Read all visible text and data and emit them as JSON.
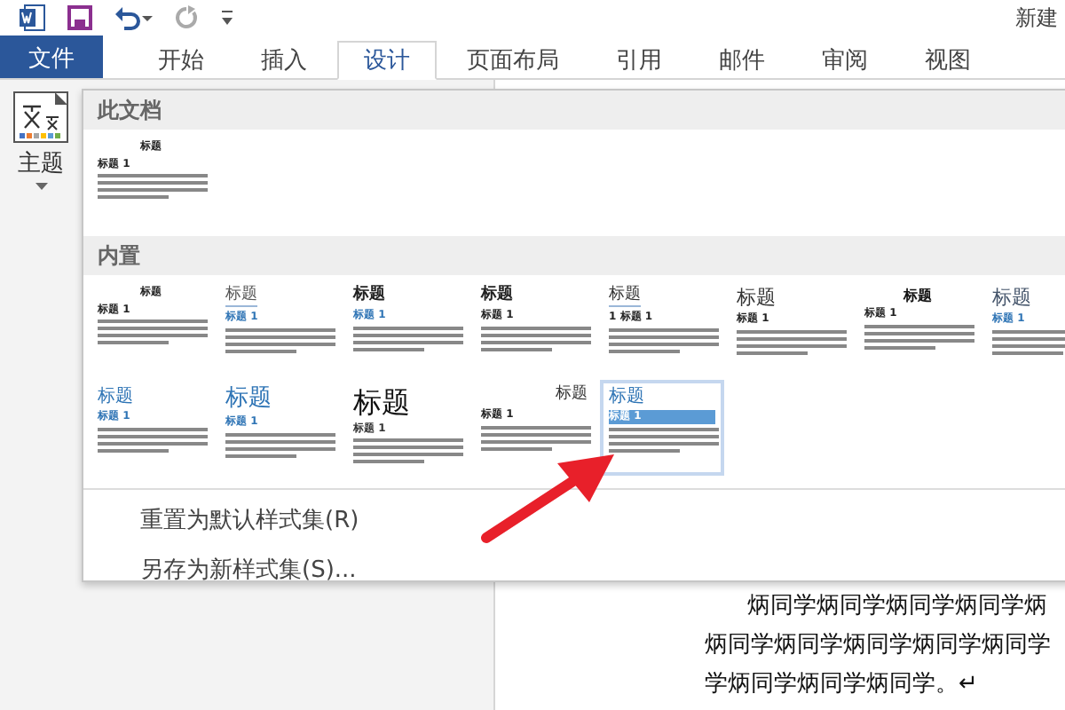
{
  "title_bar": {
    "doc_title": "新建"
  },
  "tabs": [
    {
      "label": "文件",
      "kind": "file",
      "selected": false
    },
    {
      "label": "开始",
      "kind": "tab",
      "selected": false
    },
    {
      "label": "插入",
      "kind": "tab",
      "selected": false
    },
    {
      "label": "设计",
      "kind": "tab",
      "selected": true
    },
    {
      "label": "页面布局",
      "kind": "tab",
      "selected": false
    },
    {
      "label": "引用",
      "kind": "tab",
      "selected": false
    },
    {
      "label": "邮件",
      "kind": "tab",
      "selected": false
    },
    {
      "label": "审阅",
      "kind": "tab",
      "selected": false
    },
    {
      "label": "视图",
      "kind": "tab",
      "selected": false
    }
  ],
  "theme_button": {
    "label": "主题"
  },
  "gallery": {
    "sections": [
      {
        "header": "此文档",
        "items": [
          {
            "title": "标题",
            "heading": "标题 1",
            "kind": "small-center",
            "selected": false
          }
        ]
      },
      {
        "header": "内置",
        "items": [
          {
            "title": "标题",
            "heading": "标题 1",
            "kind": "small-center",
            "selected": false
          },
          {
            "title": "标题",
            "heading": "标题 1",
            "kind": "underlined",
            "selected": false
          },
          {
            "title": "标题",
            "heading": "标题 1",
            "kind": "bold",
            "selected": false
          },
          {
            "title": "标题",
            "heading": "标题 1",
            "kind": "bold-plain",
            "selected": false
          },
          {
            "title": "标题",
            "heading": "1 标题 1",
            "kind": "numbered",
            "selected": false
          },
          {
            "title": "标题",
            "heading": "标题 1",
            "kind": "serif",
            "selected": false
          },
          {
            "title": "标题",
            "heading": "标题 1",
            "kind": "center-bold",
            "selected": false
          },
          {
            "title": "标题",
            "heading": "标题 1",
            "kind": "slate",
            "selected": false
          },
          {
            "title": "标题",
            "heading": "标题 1",
            "kind": "blue",
            "selected": false
          },
          {
            "title": "标题",
            "heading": "标题 1",
            "kind": "blue-large",
            "selected": false
          },
          {
            "title": "标题",
            "heading": "标题 1",
            "kind": "huge",
            "selected": false
          },
          {
            "title": "标题",
            "heading": "标题 1",
            "kind": "right",
            "selected": false
          },
          {
            "title": "标题",
            "heading": "标题 1",
            "kind": "band",
            "selected": true
          }
        ]
      }
    ]
  },
  "menu_items": [
    {
      "label": "重置为默认样式集(R)"
    },
    {
      "label": "另存为新样式集(S)..."
    }
  ],
  "document": {
    "lines": [
      "炳同学炳同学炳同学炳同学炳",
      "炳同学炳同学炳同学炳同学炳同学",
      "学炳同学炳同学炳同学。↵"
    ]
  }
}
